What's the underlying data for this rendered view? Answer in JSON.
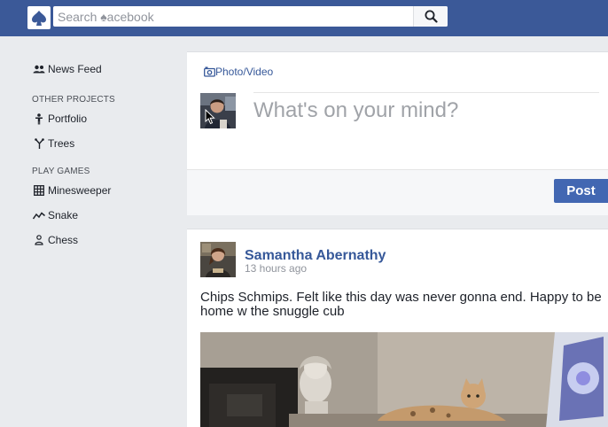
{
  "header": {
    "search_placeholder": "Search ♠acebook",
    "brand_color": "#3b5998"
  },
  "sidebar": {
    "news_feed": "News Feed",
    "other_projects_heading": "OTHER PROJECTS",
    "other_projects": [
      "Portfolio",
      "Trees"
    ],
    "play_games_heading": "PLAY GAMES",
    "games": [
      "Minesweeper",
      "Snake",
      "Chess"
    ]
  },
  "composer": {
    "tab_label": "Photo/Video",
    "placeholder": "What's on your mind?",
    "post_label": "Post"
  },
  "post": {
    "author": "Samantha Abernathy",
    "time": "13 hours ago",
    "text": "Chips Schmips. Felt like this day was never gonna end. Happy to be home w the snuggle cub"
  },
  "icons": {
    "logo": "spade-logo-icon",
    "search": "search-icon",
    "news_feed": "people-icon",
    "portfolio": "person-icon",
    "trees": "tree-branch-icon",
    "minesweeper": "grid-icon",
    "snake": "zigzag-icon",
    "chess": "pawn-icon",
    "photo": "camera-icon"
  }
}
